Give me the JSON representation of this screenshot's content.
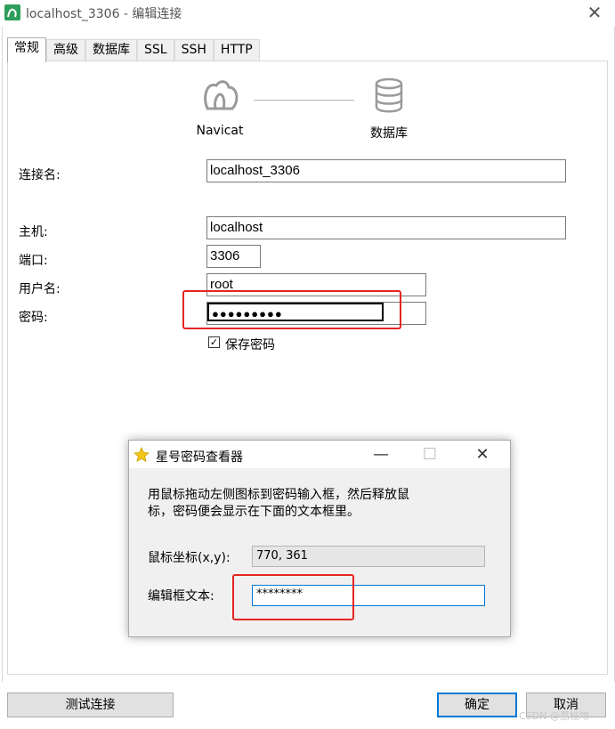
{
  "window": {
    "title": "localhost_3306 - 编辑连接"
  },
  "tabs": [
    {
      "label": "常规",
      "active": true
    },
    {
      "label": "高级"
    },
    {
      "label": "数据库"
    },
    {
      "label": "SSL"
    },
    {
      "label": "SSH"
    },
    {
      "label": "HTTP"
    }
  ],
  "header": {
    "left_label": "Navicat",
    "right_label": "数据库",
    "left_icon": "navicat-seal-icon",
    "right_icon": "database-icon"
  },
  "form": {
    "connection_name_label": "连接名:",
    "connection_name_value": "localhost_3306",
    "host_label": "主机:",
    "host_value": "localhost",
    "port_label": "端口:",
    "port_value": "3306",
    "username_label": "用户名:",
    "username_value": "root",
    "password_label": "密码:",
    "password_value": "●●●●●●●●●",
    "save_password_label": "保存密码",
    "save_password_checked": true
  },
  "buttons": {
    "test_connection": "测试连接",
    "ok": "确定",
    "cancel": "取消"
  },
  "popup": {
    "title": "星号密码查看器",
    "instructions_line1": "用鼠标拖动左侧图标到密码输入框，然后释放鼠",
    "instructions_line2": "标，密码便会显示在下面的文本框里。",
    "coords_label": "鼠标坐标(x,y):",
    "coords_value": "770, 361",
    "edit_text_label": "编辑框文本:",
    "edit_text_value": "********"
  },
  "watermark": "CSDN @荔枝吻",
  "colors": {
    "highlight_red": "#e32521",
    "accent_blue": "#0078d7",
    "navicat_green": "#3cb371"
  }
}
